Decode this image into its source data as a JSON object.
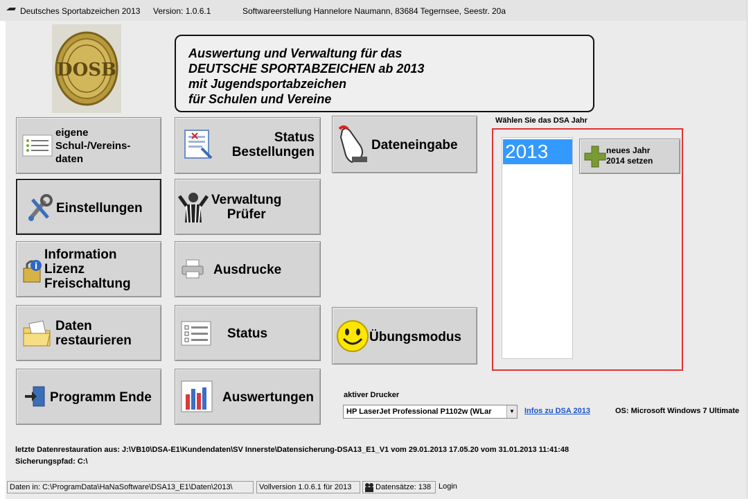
{
  "titlebar": {
    "app": "Deutsches Sportabzeichen  2013",
    "version": "Version: 1.0.6.1",
    "author": "Softwareerstellung Hannelore Naumann, 83684 Tegernsee, Seestr. 20a"
  },
  "logo": {
    "text": "DOSB"
  },
  "banner": {
    "lines": [
      "Auswertung und Verwaltung für das",
      "DEUTSCHE SPORTABZEICHEN ab 2013",
      "mit Jugendsportabzeichen",
      "für Schulen und Vereine"
    ]
  },
  "buttons": {
    "eigene": [
      "eigene",
      "Schul-/Vereins-",
      "daten"
    ],
    "status_bestellungen": [
      "Status",
      "Bestellungen"
    ],
    "dateneingabe": "Dateneingabe",
    "einstellungen": "Einstellungen",
    "verwaltung": [
      "Verwaltung",
      "Prüfer"
    ],
    "information": [
      "Information",
      "Lizenz",
      "Freischaltung"
    ],
    "ausdrucke": "Ausdrucke",
    "daten_restaurieren": [
      "Daten",
      "restaurieren"
    ],
    "status": "Status",
    "uebungsmodus": "Übungsmodus",
    "programm_ende": "Programm Ende",
    "auswertungen": "Auswertungen"
  },
  "year_panel": {
    "label": "Wählen Sie das DSA Jahr",
    "years": [
      "2013"
    ],
    "selected": "2013",
    "new_year_button": [
      "neues Jahr",
      "2014 setzen"
    ]
  },
  "printer": {
    "label": "aktiver Drucker",
    "value": "HP LaserJet Professional P1102w (WLar",
    "info_link": "Infos zu DSA 2013",
    "os": "OS: Microsoft Windows 7 Ultimate"
  },
  "footer": {
    "restore": "letzte Datenrestauration aus: J:\\VB10\\DSA-E1\\Kundendaten\\SV Innerste\\Datensicherung-DSA13_E1_V1 vom 29.01.2013 17.05.20 vom  31.01.2013 11:41:48",
    "savepath": "Sicherungspfad: C:\\"
  },
  "statusbar": {
    "data_path": "Daten in: C:\\ProgramData\\HaNaSoftware\\DSA13_E1\\Daten\\2013\\",
    "version": "Vollversion 1.0.6.1   für 2013",
    "records": "Datensätze: 138",
    "login": "Login"
  },
  "colors": {
    "accent_border": "#e23232",
    "selection": "#3399ff",
    "link": "#1a55cc"
  }
}
